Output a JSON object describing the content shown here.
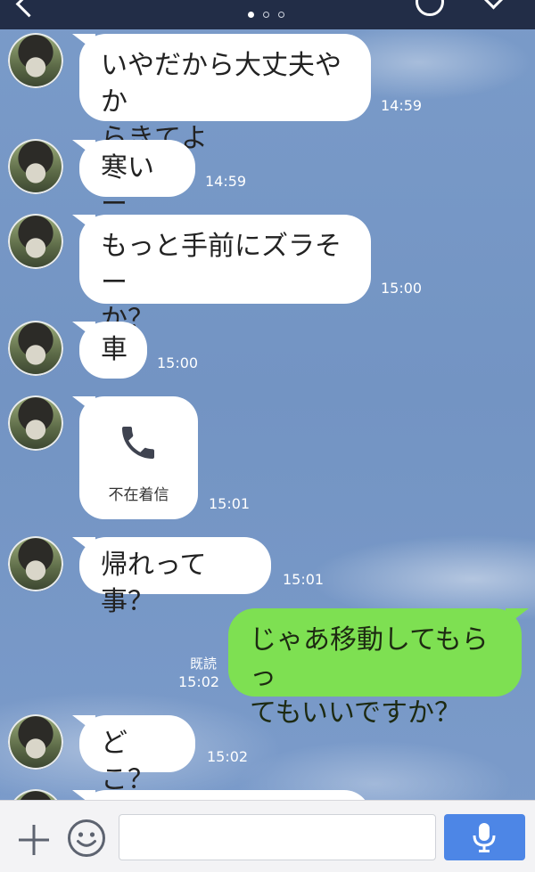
{
  "header": {
    "page_index": 0,
    "page_count": 3
  },
  "messages": {
    "m1": {
      "text_line1": "いやだから大丈夫やか",
      "text_line2": "らきてよ",
      "time": "14:59"
    },
    "m2": {
      "text": "寒いー",
      "time": "14:59"
    },
    "m3": {
      "text_line1": "もっと手前にズラそー",
      "text_line2": "か？",
      "time": "15:00"
    },
    "m4": {
      "text": "車",
      "time": "15:00"
    },
    "m5": {
      "label": "不在着信",
      "time": "15:01"
    },
    "m6": {
      "text": "帰れって事？",
      "time": "15:01"
    },
    "m7": {
      "text_line1": "じゃあ移動してもらっ",
      "text_line2": "てもいいですか？",
      "read_label": "既読",
      "time": "15:02"
    },
    "m8": {
      "text": "どこ？",
      "time": "15:02"
    }
  },
  "composer": {
    "placeholder": ""
  },
  "colors": {
    "header_bg": "#222d47",
    "chat_bg": "#7394c3",
    "own_bubble": "#7ee052",
    "mic_button": "#4d86e6"
  },
  "icons": {
    "back": "chevron-left-icon",
    "call": "phone-icon",
    "plus": "plus-icon",
    "sticker": "smile-icon",
    "mic": "microphone-icon"
  }
}
